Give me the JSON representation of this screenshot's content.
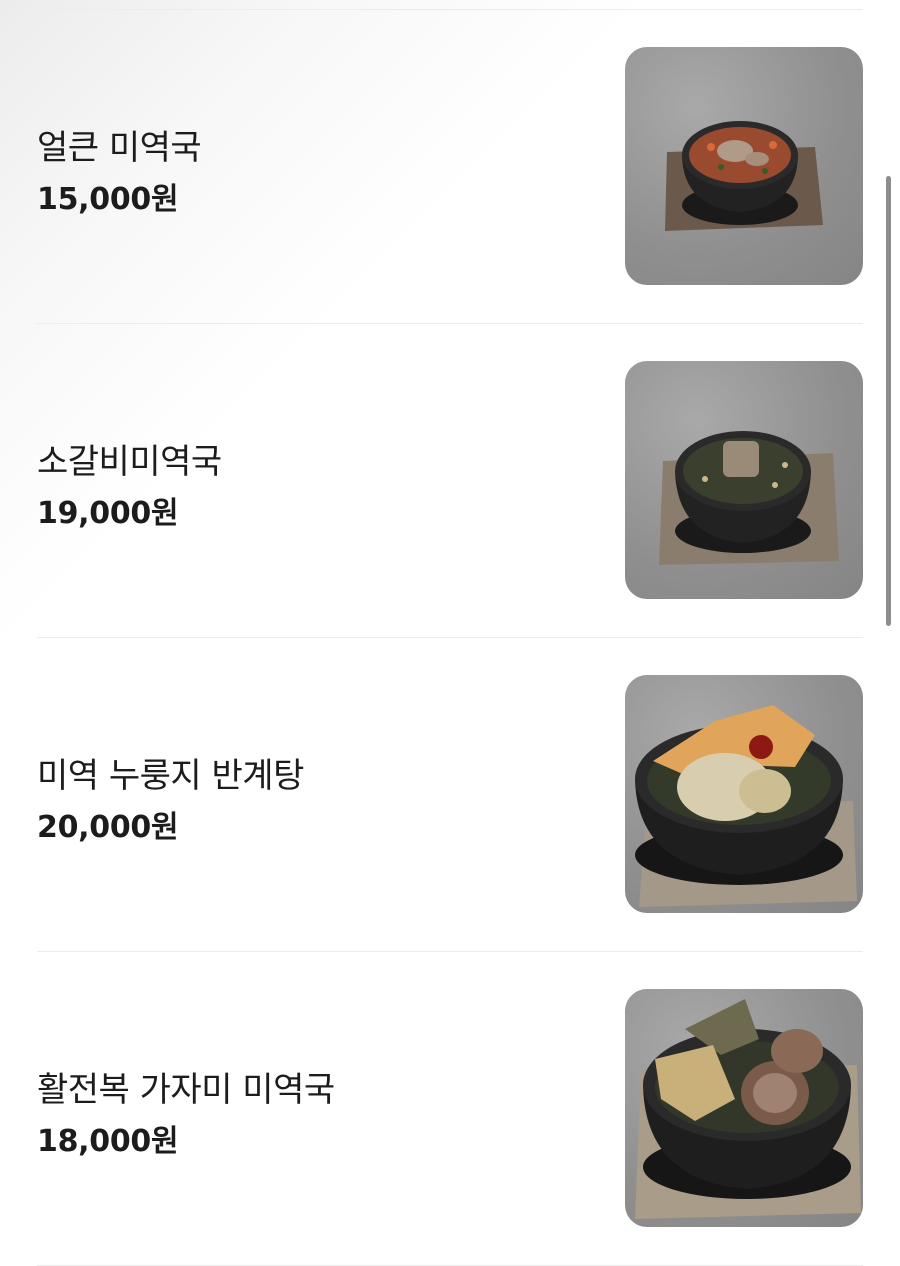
{
  "menu": {
    "items": [
      {
        "name": "얼큰 미역국",
        "price": "15,000원",
        "image_icon": "spicy-seaweed-soup-photo"
      },
      {
        "name": "소갈비미역국",
        "price": "19,000원",
        "image_icon": "beef-rib-seaweed-soup-photo"
      },
      {
        "name": "미역 누룽지 반계탕",
        "price": "20,000원",
        "image_icon": "seaweed-nurungji-chicken-soup-photo"
      },
      {
        "name": "활전복 가자미 미역국",
        "price": "18,000원",
        "image_icon": "abalone-flounder-seaweed-soup-photo"
      }
    ]
  }
}
